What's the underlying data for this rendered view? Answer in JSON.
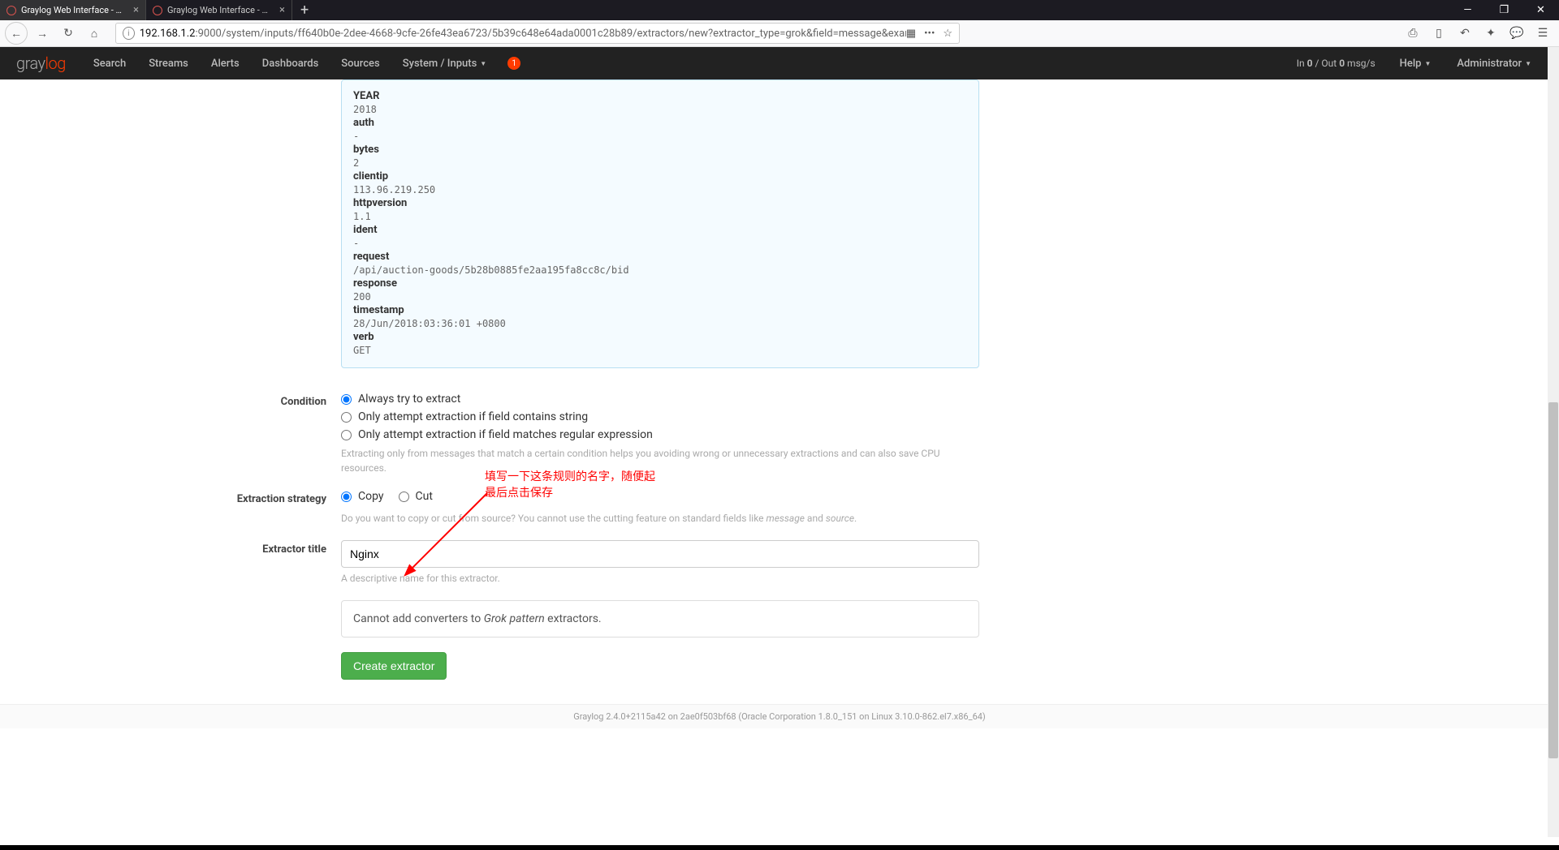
{
  "browser": {
    "tabs": [
      {
        "title": "Graylog Web Interface - New",
        "active": true
      },
      {
        "title": "Graylog Web Interface - Gra",
        "active": false
      }
    ],
    "url_host": "192.168.1.2",
    "url_path": ":9000/system/inputs/ff640b0e-2dee-4668-9cfe-26fe43ea6723/5b39c648e64ada0001c28b89/extractors/new?extractor_type=grok&field=message&example_index=gray"
  },
  "nav": {
    "logo_gray": "gray",
    "logo_log": "log",
    "items": [
      "Search",
      "Streams",
      "Alerts",
      "Dashboards",
      "Sources",
      "System / Inputs"
    ],
    "badge": "1",
    "status_in": "0",
    "status_out": "0",
    "status_prefix": "In ",
    "status_sep": " / Out ",
    "status_suffix": " msg/s",
    "help": "Help",
    "admin": "Administrator"
  },
  "preview": {
    "fields": [
      {
        "key": "YEAR",
        "val": "2018"
      },
      {
        "key": "auth",
        "val": "-"
      },
      {
        "key": "bytes",
        "val": "2"
      },
      {
        "key": "clientip",
        "val": "113.96.219.250"
      },
      {
        "key": "httpversion",
        "val": "1.1"
      },
      {
        "key": "ident",
        "val": "-"
      },
      {
        "key": "request",
        "val": "/api/auction-goods/5b28b0885fe2aa195fa8cc8c/bid"
      },
      {
        "key": "response",
        "val": "200"
      },
      {
        "key": "timestamp",
        "val": "28/Jun/2018:03:36:01 +0800"
      },
      {
        "key": "verb",
        "val": "GET"
      }
    ]
  },
  "form": {
    "condition": {
      "label": "Condition",
      "options": [
        "Always try to extract",
        "Only attempt extraction if field contains string",
        "Only attempt extraction if field matches regular expression"
      ],
      "help": "Extracting only from messages that match a certain condition helps you avoiding wrong or unnecessary extractions and can also save CPU resources."
    },
    "strategy": {
      "label": "Extraction strategy",
      "copy": "Copy",
      "cut": "Cut",
      "help_a": "Do you want to copy or cut from source? You cannot use the cutting feature on standard fields like ",
      "help_b": "message",
      "help_c": " and ",
      "help_d": "source",
      "help_e": "."
    },
    "title": {
      "label": "Extractor title",
      "value": "Nginx",
      "help": "A descriptive name for this extractor."
    },
    "converters_a": "Cannot add converters to ",
    "converters_b": "Grok pattern",
    "converters_c": " extractors.",
    "submit": "Create extractor"
  },
  "annotation": {
    "line1": "填写一下这条规则的名字，随便起",
    "line2": "最后点击保存"
  },
  "footer": "Graylog 2.4.0+2115a42 on 2ae0f503bf68 (Oracle Corporation 1.8.0_151 on Linux 3.10.0-862.el7.x86_64)"
}
